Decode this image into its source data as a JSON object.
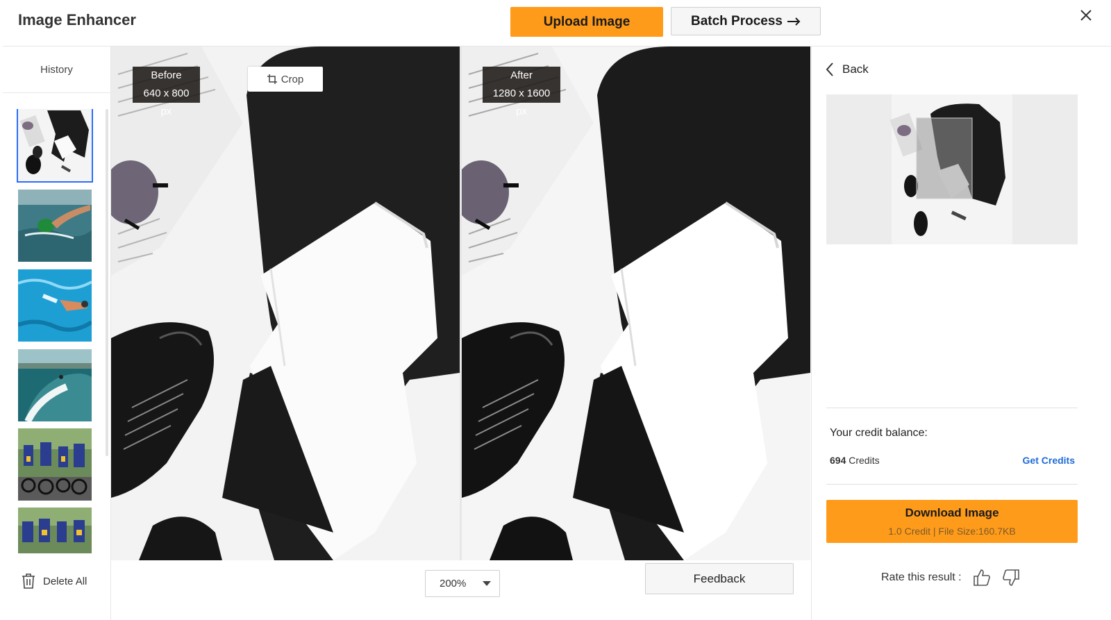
{
  "header": {
    "title": "Image Enhancer",
    "upload_label": "Upload Image",
    "batch_label": "Batch Process"
  },
  "sidebar": {
    "history_label": "History",
    "delete_all_label": "Delete All",
    "thumbnails": [
      "fashion flat-lay",
      "swimmer",
      "pool swimmer",
      "surfer",
      "cyclists",
      "cyclists"
    ]
  },
  "compare": {
    "before_label": "Before",
    "before_size": "640 x 800 px",
    "after_label": "After",
    "after_size": "1280 x 1600 px",
    "crop_label": "Crop"
  },
  "bottom": {
    "zoom_value": "200%",
    "feedback_label": "Feedback"
  },
  "right_panel": {
    "back_label": "Back",
    "credit_balance_label": "Your credit balance:",
    "credits_count": "694",
    "credits_unit": "Credits",
    "get_credits_label": "Get Credits",
    "download_label": "Download Image",
    "download_sub": "1.0 Credit | File Size:160.7KB",
    "rate_label": "Rate this result :"
  },
  "colors": {
    "accent_orange": "#ff9b1a",
    "selection_blue": "#2a6cff",
    "link_blue": "#1f6bd6"
  },
  "icons": [
    "close-icon",
    "arrow-right-icon",
    "crop-icon",
    "trash-icon",
    "chevron-left-icon",
    "thumbs-up-icon",
    "thumbs-down-icon",
    "dropdown-caret-icon"
  ]
}
